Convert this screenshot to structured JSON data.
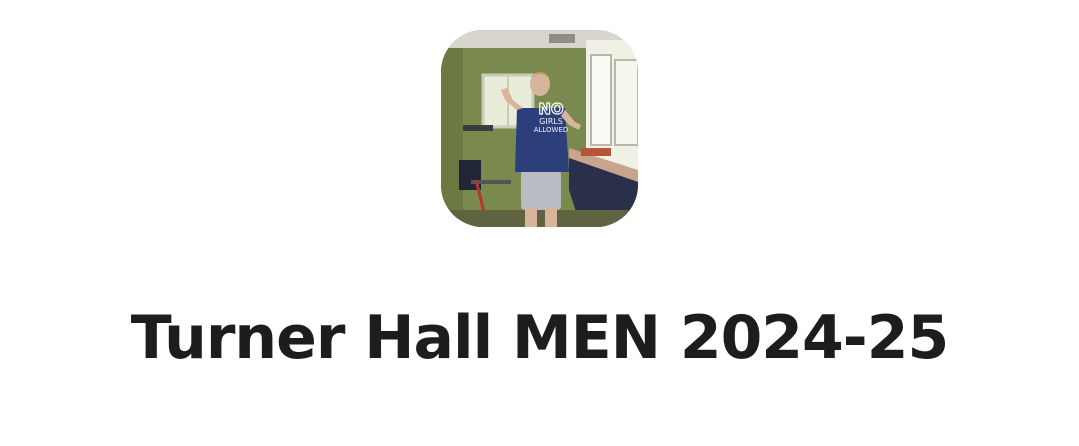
{
  "profile": {
    "title": "Turner Hall MEN 2024-25",
    "avatar": {
      "description": "profile photo",
      "shirt_text": [
        "NO",
        "GIRLS",
        "ALLOWED"
      ]
    }
  }
}
